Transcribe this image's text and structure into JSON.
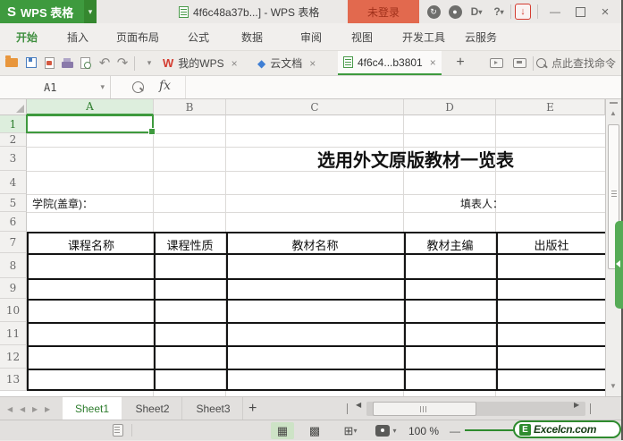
{
  "title_bar": {
    "logo_letter": "S",
    "app_name": "WPS 表格",
    "document_title": "4f6c48a37b...] - WPS 表格",
    "login_label": "未登录",
    "help_label": "?",
    "d_tool_label": "D"
  },
  "menu_bar": {
    "items": [
      {
        "label": "开始"
      },
      {
        "label": "插入"
      },
      {
        "label": "页面布局"
      },
      {
        "label": "公式"
      },
      {
        "label": "数据"
      },
      {
        "label": "审阅"
      },
      {
        "label": "视图"
      },
      {
        "label": "开发工具"
      },
      {
        "label": "云服务"
      }
    ],
    "active": "开始"
  },
  "toolbar": {
    "tabs": [
      {
        "label": "我的WPS"
      },
      {
        "label": "云文档"
      },
      {
        "label": "4f6c4...b3801",
        "active": true
      }
    ],
    "w_logo": "W",
    "cube_glyph": "◆",
    "search_label": "点此查找命令"
  },
  "formula_bar": {
    "name_box": "A1",
    "fx_label": "fx",
    "formula_value": ""
  },
  "grid": {
    "columns": [
      "A",
      "B",
      "C",
      "D",
      "E"
    ],
    "selected_column": "A",
    "row_numbers": [
      "1",
      "2",
      "3",
      "4",
      "5",
      "6",
      "7",
      "8",
      "9",
      "10",
      "11",
      "12",
      "13"
    ],
    "selected_row": "1",
    "sheet_title": "选用外文原版教材一览表",
    "college_label": "学院(盖章)：",
    "form_filler_label": "填表人：",
    "table_headers": [
      "课程名称",
      "课程性质",
      "教材名称",
      "教材主编",
      "出版社"
    ]
  },
  "sheet_bar": {
    "sheets": [
      {
        "label": "Sheet1",
        "active": true
      },
      {
        "label": "Sheet2"
      },
      {
        "label": "Sheet3"
      }
    ],
    "add_label": "+"
  },
  "status_bar": {
    "zoom_level": "100 %",
    "zoom_out": "—",
    "watermark_letter": "E",
    "watermark_text": "Excelcn.com"
  },
  "glyphs": {
    "close": "×",
    "plus": "+",
    "caret": "▾",
    "up": "▲",
    "down": "▼",
    "left": "◀",
    "right": "▶",
    "undo": "↶",
    "redo": "↷",
    "minimize": "—",
    "circle_arrow": "↻",
    "circle_dot": "●",
    "download": "↓",
    "view_normal": "▦",
    "view_break": "▩",
    "view_layout": "⊞"
  }
}
